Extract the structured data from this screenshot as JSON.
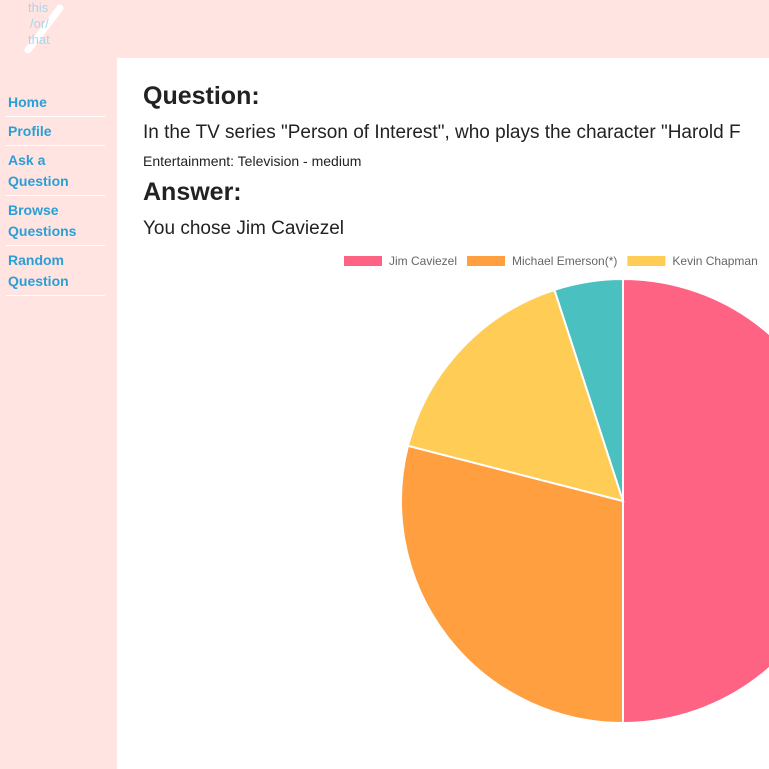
{
  "logo": {
    "lines": [
      "this",
      "/or/",
      "that"
    ]
  },
  "nav": {
    "items": [
      {
        "label": "Home",
        "lines": [
          "Home"
        ]
      },
      {
        "label": "Profile",
        "lines": [
          "Profile"
        ]
      },
      {
        "label": "Ask a Question",
        "lines": [
          "Ask a",
          "Question"
        ]
      },
      {
        "label": "Browse Questions",
        "lines": [
          "Browse",
          "Questions"
        ]
      },
      {
        "label": "Random Question",
        "lines": [
          "Random",
          "Question"
        ]
      }
    ]
  },
  "question": {
    "heading": "Question:",
    "text": "In the TV series \"Person of Interest\", who plays the character \"Harold F",
    "category": "Entertainment: Television - medium"
  },
  "answer": {
    "heading": "Answer:",
    "text": "You chose Jim Caviezel"
  },
  "colors": {
    "background": "#ffe4e1",
    "link": "#2a9fd6",
    "series": [
      "#ff6384",
      "#ff9f40",
      "#ffcd56",
      "#4bc0c0"
    ]
  },
  "chart_data": {
    "type": "pie",
    "categories": [
      "Jim Caviezel",
      "Michael Emerson(*)",
      "Kevin Chapman",
      ""
    ],
    "values": [
      50,
      29,
      16,
      5
    ],
    "legend_entries": [
      "Jim Caviezel",
      "Michael Emerson(*)",
      "Kevin Chapman"
    ],
    "legend": "top"
  }
}
